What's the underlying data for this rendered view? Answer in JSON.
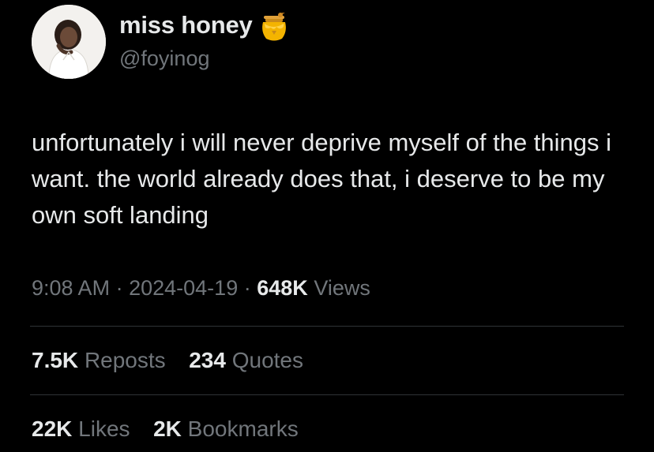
{
  "author": {
    "display_name": "miss honey",
    "handle": "@foyinog",
    "badge_icon": "honey-pot-icon",
    "avatar_icon": "profile-photo"
  },
  "tweet": {
    "text": "unfortunately i will never deprive myself of the things i want. the world already does that, i deserve to be my own soft landing"
  },
  "meta": {
    "time": "9:08 AM",
    "separator": "·",
    "date": "2024-04-19",
    "views_count": "648K",
    "views_label": "Views"
  },
  "stats": {
    "reposts_count": "7.5K",
    "reposts_label": "Reposts",
    "quotes_count": "234",
    "quotes_label": "Quotes",
    "likes_count": "22K",
    "likes_label": "Likes",
    "bookmarks_count": "2K",
    "bookmarks_label": "Bookmarks"
  },
  "colors": {
    "background": "#000000",
    "primary_text": "#e7e9ea",
    "secondary_text": "#71767b",
    "divider": "#2f3336",
    "honey": "#f4b400"
  }
}
